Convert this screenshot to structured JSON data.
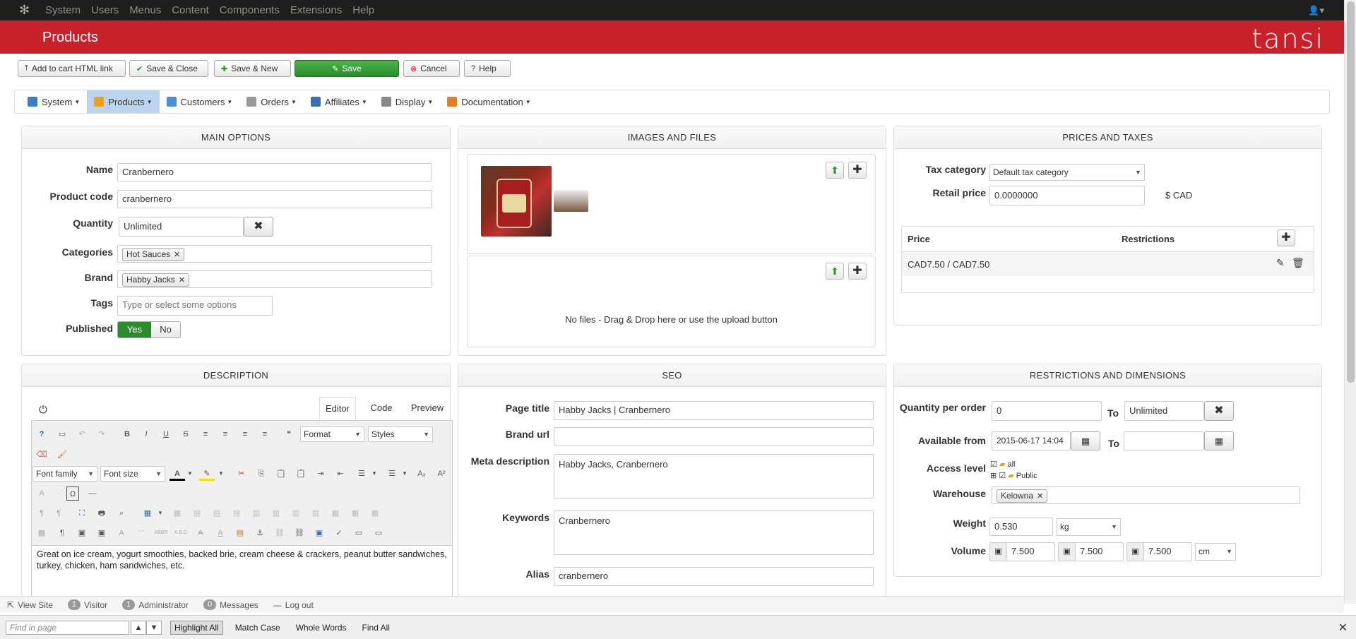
{
  "topmenu": {
    "items": [
      "System",
      "Users",
      "Menus",
      "Content",
      "Components",
      "Extensions",
      "Help"
    ]
  },
  "header": {
    "title": "Products",
    "brand": "tansi"
  },
  "toolbar": {
    "add_cart": "Add to cart HTML link",
    "save_close": "Save & Close",
    "save_new": "Save & New",
    "save": "Save",
    "cancel": "Cancel",
    "help": "Help"
  },
  "nav": {
    "items": [
      {
        "label": "System",
        "color": "#3a7fc4"
      },
      {
        "label": "Products",
        "color": "#f0a020"
      },
      {
        "label": "Customers",
        "color": "#4a8fd4"
      },
      {
        "label": "Orders",
        "color": "#888"
      },
      {
        "label": "Affiliates",
        "color": "#3a70b0"
      },
      {
        "label": "Display",
        "color": "#888"
      },
      {
        "label": "Documentation",
        "color": "#e08020"
      }
    ]
  },
  "main": {
    "title": "MAIN OPTIONS",
    "name_label": "Name",
    "name": "Cranbernero",
    "code_label": "Product code",
    "code": "cranbernero",
    "qty_label": "Quantity",
    "qty": "Unlimited",
    "cat_label": "Categories",
    "cat": "Hot Sauces",
    "brand_label": "Brand",
    "brand": "Habby Jacks",
    "tags_label": "Tags",
    "tags_ph": "Type or select some options",
    "pub_label": "Published",
    "yes": "Yes",
    "no": "No"
  },
  "images": {
    "title": "IMAGES AND FILES",
    "files_msg": "No files - Drag & Drop here or use the upload button"
  },
  "prices": {
    "title": "PRICES AND TAXES",
    "tax_label": "Tax category",
    "tax": "Default tax category",
    "retail_label": "Retail price",
    "retail": "0.0000000",
    "currency": "$ CAD",
    "col_price": "Price",
    "col_restr": "Restrictions",
    "row": "CAD7.50 / CAD7.50"
  },
  "desc": {
    "title": "DESCRIPTION",
    "tabs": [
      "Editor",
      "Code",
      "Preview"
    ],
    "format": "Format",
    "styles": "Styles",
    "font_family": "Font family",
    "font_size": "Font size",
    "text": "Great on ice cream, yogurt smoothies, backed brie, cream cheese & crackers, peanut butter sandwiches, turkey, chicken, ham sandwiches, etc."
  },
  "seo": {
    "title": "SEO",
    "page_title_label": "Page title",
    "page_title": "Habby Jacks | Cranbernero",
    "brand_url_label": "Brand url",
    "brand_url": "",
    "meta_label": "Meta description",
    "meta": "Habby Jacks, Cranbernero",
    "kw_label": "Keywords",
    "kw": "Cranbernero",
    "alias_label": "Alias",
    "alias": "cranbernero"
  },
  "restr": {
    "title": "RESTRICTIONS AND DIMENSIONS",
    "qpo_label": "Quantity per order",
    "qpo": "0",
    "to": "To",
    "qpo_to": "Unlimited",
    "avail_label": "Available from",
    "avail": "2015-06-17 14:04",
    "access_label": "Access level",
    "acc_all": "all",
    "acc_public": "Public",
    "wh_label": "Warehouse",
    "wh": "Kelowna",
    "weight_label": "Weight",
    "weight": "0.530",
    "weight_unit": "kg",
    "volume_label": "Volume",
    "v1": "7.500",
    "v2": "7.500",
    "v3": "7.500",
    "vol_unit": "cm"
  },
  "status": {
    "view_site": "View Site",
    "visitor_n": "1",
    "visitor": "Visitor",
    "admin_n": "1",
    "admin": "Administrator",
    "msg_n": "0",
    "msg": "Messages",
    "logout": "Log out"
  },
  "find": {
    "placeholder": "Find in page",
    "highlight": "Highlight All",
    "match": "Match Case",
    "whole": "Whole Words",
    "find_all": "Find All"
  }
}
